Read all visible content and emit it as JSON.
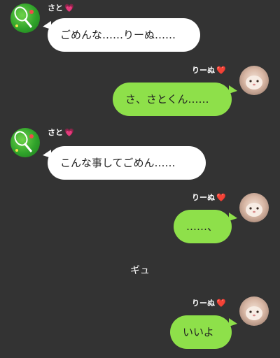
{
  "colors": {
    "background": "#333333",
    "incoming_bubble": "#ffffff",
    "outgoing_bubble": "#8ee04a",
    "name_text": "#ffffff"
  },
  "messages": [
    {
      "sender": "さと",
      "badge": "💗",
      "text": "ごめんな……りーぬ……"
    },
    {
      "sender": "りーぬ",
      "badge": "❤️",
      "text": "さ、さとくん……"
    },
    {
      "sender": "さと",
      "badge": "💗",
      "text": "こんな事してごめん……"
    },
    {
      "sender": "りーぬ",
      "badge": "❤️",
      "text": "……、"
    },
    {
      "sender": "",
      "badge": "",
      "text": "ギュ"
    },
    {
      "sender": "りーぬ",
      "badge": "❤️",
      "text": "いいよ"
    }
  ]
}
